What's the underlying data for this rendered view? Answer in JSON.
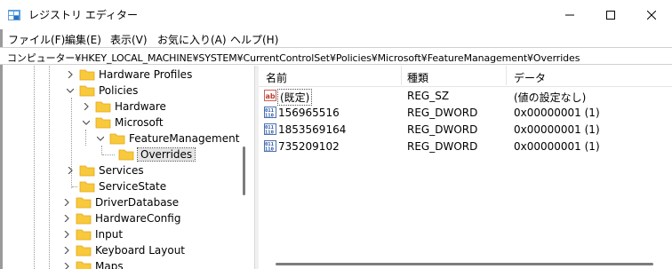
{
  "window": {
    "title": "レジストリ エディター"
  },
  "menu": [
    "ファイル(F)",
    "編集(E)",
    "表示(V)",
    "お気に入り(A)",
    "ヘルプ(H)"
  ],
  "address": "コンピューター¥HKEY_LOCAL_MACHINE¥SYSTEM¥CurrentControlSet¥Policies¥Microsoft¥FeatureManagement¥Overrides",
  "tree": [
    {
      "label": "Hardware Profiles",
      "expander": "collapsed"
    },
    {
      "label": "Policies",
      "expander": "expanded"
    },
    {
      "label": "Hardware",
      "expander": "collapsed"
    },
    {
      "label": "Microsoft",
      "expander": "expanded"
    },
    {
      "label": "FeatureManagement",
      "expander": "expanded"
    },
    {
      "label": "Overrides",
      "expander": "none",
      "selected": true
    },
    {
      "label": "Services",
      "expander": "collapsed"
    },
    {
      "label": "ServiceState",
      "expander": "none"
    },
    {
      "label": "DriverDatabase",
      "expander": "collapsed"
    },
    {
      "label": "HardwareConfig",
      "expander": "collapsed"
    },
    {
      "label": "Input",
      "expander": "collapsed"
    },
    {
      "label": "Keyboard Layout",
      "expander": "collapsed"
    },
    {
      "label": "Maps",
      "expander": "collapsed"
    }
  ],
  "list": {
    "columns": [
      "名前",
      "種類",
      "データ"
    ],
    "rows": [
      {
        "name": "(既定)",
        "type": "REG_SZ",
        "data": "(値の設定なし)",
        "icon": "string-value-icon"
      },
      {
        "name": "156965516",
        "type": "REG_DWORD",
        "data": "0x00000001 (1)",
        "icon": "dword-value-icon"
      },
      {
        "name": "1853569164",
        "type": "REG_DWORD",
        "data": "0x00000001 (1)",
        "icon": "dword-value-icon"
      },
      {
        "name": "735209102",
        "type": "REG_DWORD",
        "data": "0x00000001 (1)",
        "icon": "dword-value-icon"
      }
    ]
  },
  "colors": {
    "folder": "#f8c93d",
    "folder_dark": "#e2a714",
    "selection": "#e5e5e5",
    "string_icon": "#c0392b",
    "dword_icon": "#1f4e9c"
  }
}
